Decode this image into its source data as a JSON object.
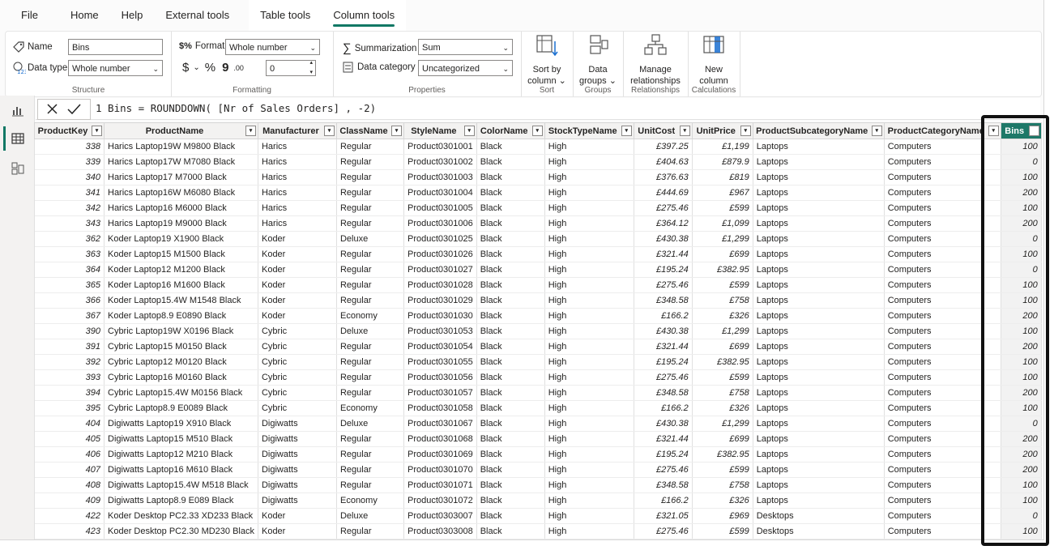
{
  "tabs": [
    "File",
    "Home",
    "Help",
    "External tools",
    "Table tools",
    "Column tools"
  ],
  "ribbon": {
    "structure": {
      "name_label": "Name",
      "name_value": "Bins",
      "datatype_label": "Data type",
      "datatype_value": "Whole number",
      "group_label": "Structure"
    },
    "formatting": {
      "format_label": "Format",
      "format_value": "Whole number",
      "currency": "$",
      "chev": "⌄",
      "percent": "%",
      "comma": "9",
      "decimals": ".00",
      "decimal_value": "0",
      "group_label": "Formatting"
    },
    "properties": {
      "summ_label": "Summarization",
      "summ_value": "Sum",
      "cat_label": "Data category",
      "cat_value": "Uncategorized",
      "group_label": "Properties"
    },
    "sort": {
      "label1": "Sort by",
      "label2": "column",
      "group_label": "Sort"
    },
    "groups": {
      "label1": "Data",
      "label2": "groups",
      "group_label": "Groups"
    },
    "relationships": {
      "label1": "Manage",
      "label2": "relationships",
      "group_label": "Relationships"
    },
    "calculations": {
      "label1": "New",
      "label2": "column",
      "group_label": "Calculations"
    }
  },
  "formula": "1 Bins = ROUNDDOWN( [Nr of Sales Orders] , -2)",
  "columns": [
    "ProductKey",
    "ProductName",
    "Manufacturer",
    "ClassName",
    "StyleName",
    "ColorName",
    "StockTypeName",
    "UnitCost",
    "UnitPrice",
    "ProductSubcategoryName",
    "ProductCategoryName",
    "Bins"
  ],
  "rows": [
    [
      "338",
      "Harics Laptop19W M9800 Black",
      "Harics",
      "Regular",
      "Product0301001",
      "Black",
      "High",
      "£397.25",
      "£1,199",
      "Laptops",
      "Computers",
      "100"
    ],
    [
      "339",
      "Harics Laptop17W M7080 Black",
      "Harics",
      "Regular",
      "Product0301002",
      "Black",
      "High",
      "£404.63",
      "£879.9",
      "Laptops",
      "Computers",
      "0"
    ],
    [
      "340",
      "Harics Laptop17 M7000 Black",
      "Harics",
      "Regular",
      "Product0301003",
      "Black",
      "High",
      "£376.63",
      "£819",
      "Laptops",
      "Computers",
      "100"
    ],
    [
      "341",
      "Harics Laptop16W M6080 Black",
      "Harics",
      "Regular",
      "Product0301004",
      "Black",
      "High",
      "£444.69",
      "£967",
      "Laptops",
      "Computers",
      "200"
    ],
    [
      "342",
      "Harics Laptop16 M6000 Black",
      "Harics",
      "Regular",
      "Product0301005",
      "Black",
      "High",
      "£275.46",
      "£599",
      "Laptops",
      "Computers",
      "100"
    ],
    [
      "343",
      "Harics Laptop19 M9000 Black",
      "Harics",
      "Regular",
      "Product0301006",
      "Black",
      "High",
      "£364.12",
      "£1,099",
      "Laptops",
      "Computers",
      "200"
    ],
    [
      "362",
      "Koder Laptop19 X1900 Black",
      "Koder",
      "Deluxe",
      "Product0301025",
      "Black",
      "High",
      "£430.38",
      "£1,299",
      "Laptops",
      "Computers",
      "0"
    ],
    [
      "363",
      "Koder Laptop15 M1500 Black",
      "Koder",
      "Regular",
      "Product0301026",
      "Black",
      "High",
      "£321.44",
      "£699",
      "Laptops",
      "Computers",
      "100"
    ],
    [
      "364",
      "Koder Laptop12 M1200 Black",
      "Koder",
      "Regular",
      "Product0301027",
      "Black",
      "High",
      "£195.24",
      "£382.95",
      "Laptops",
      "Computers",
      "0"
    ],
    [
      "365",
      "Koder Laptop16 M1600 Black",
      "Koder",
      "Regular",
      "Product0301028",
      "Black",
      "High",
      "£275.46",
      "£599",
      "Laptops",
      "Computers",
      "100"
    ],
    [
      "366",
      "Koder Laptop15.4W M1548 Black",
      "Koder",
      "Regular",
      "Product0301029",
      "Black",
      "High",
      "£348.58",
      "£758",
      "Laptops",
      "Computers",
      "100"
    ],
    [
      "367",
      "Koder Laptop8.9 E0890 Black",
      "Koder",
      "Economy",
      "Product0301030",
      "Black",
      "High",
      "£166.2",
      "£326",
      "Laptops",
      "Computers",
      "200"
    ],
    [
      "390",
      "Cybric Laptop19W X0196 Black",
      "Cybric",
      "Deluxe",
      "Product0301053",
      "Black",
      "High",
      "£430.38",
      "£1,299",
      "Laptops",
      "Computers",
      "100"
    ],
    [
      "391",
      "Cybric Laptop15 M0150 Black",
      "Cybric",
      "Regular",
      "Product0301054",
      "Black",
      "High",
      "£321.44",
      "£699",
      "Laptops",
      "Computers",
      "200"
    ],
    [
      "392",
      "Cybric Laptop12 M0120 Black",
      "Cybric",
      "Regular",
      "Product0301055",
      "Black",
      "High",
      "£195.24",
      "£382.95",
      "Laptops",
      "Computers",
      "100"
    ],
    [
      "393",
      "Cybric Laptop16 M0160 Black",
      "Cybric",
      "Regular",
      "Product0301056",
      "Black",
      "High",
      "£275.46",
      "£599",
      "Laptops",
      "Computers",
      "100"
    ],
    [
      "394",
      "Cybric Laptop15.4W M0156 Black",
      "Cybric",
      "Regular",
      "Product0301057",
      "Black",
      "High",
      "£348.58",
      "£758",
      "Laptops",
      "Computers",
      "200"
    ],
    [
      "395",
      "Cybric Laptop8.9 E0089 Black",
      "Cybric",
      "Economy",
      "Product0301058",
      "Black",
      "High",
      "£166.2",
      "£326",
      "Laptops",
      "Computers",
      "100"
    ],
    [
      "404",
      "Digiwatts Laptop19 X910 Black",
      "Digiwatts",
      "Deluxe",
      "Product0301067",
      "Black",
      "High",
      "£430.38",
      "£1,299",
      "Laptops",
      "Computers",
      "0"
    ],
    [
      "405",
      "Digiwatts Laptop15 M510 Black",
      "Digiwatts",
      "Regular",
      "Product0301068",
      "Black",
      "High",
      "£321.44",
      "£699",
      "Laptops",
      "Computers",
      "200"
    ],
    [
      "406",
      "Digiwatts Laptop12 M210 Black",
      "Digiwatts",
      "Regular",
      "Product0301069",
      "Black",
      "High",
      "£195.24",
      "£382.95",
      "Laptops",
      "Computers",
      "200"
    ],
    [
      "407",
      "Digiwatts Laptop16 M610 Black",
      "Digiwatts",
      "Regular",
      "Product0301070",
      "Black",
      "High",
      "£275.46",
      "£599",
      "Laptops",
      "Computers",
      "200"
    ],
    [
      "408",
      "Digiwatts Laptop15.4W M518 Black",
      "Digiwatts",
      "Regular",
      "Product0301071",
      "Black",
      "High",
      "£348.58",
      "£758",
      "Laptops",
      "Computers",
      "100"
    ],
    [
      "409",
      "Digiwatts Laptop8.9 E089 Black",
      "Digiwatts",
      "Economy",
      "Product0301072",
      "Black",
      "High",
      "£166.2",
      "£326",
      "Laptops",
      "Computers",
      "100"
    ],
    [
      "422",
      "Koder Desktop PC2.33 XD233 Black",
      "Koder",
      "Deluxe",
      "Product0303007",
      "Black",
      "High",
      "£321.05",
      "£969",
      "Desktops",
      "Computers",
      "0"
    ],
    [
      "423",
      "Koder Desktop PC2.30 MD230 Black",
      "Koder",
      "Regular",
      "Product0303008",
      "Black",
      "High",
      "£275.46",
      "£599",
      "Desktops",
      "Computers",
      "100"
    ]
  ],
  "numeric_cols": [
    0,
    7,
    8,
    11
  ],
  "accent": "#117865"
}
